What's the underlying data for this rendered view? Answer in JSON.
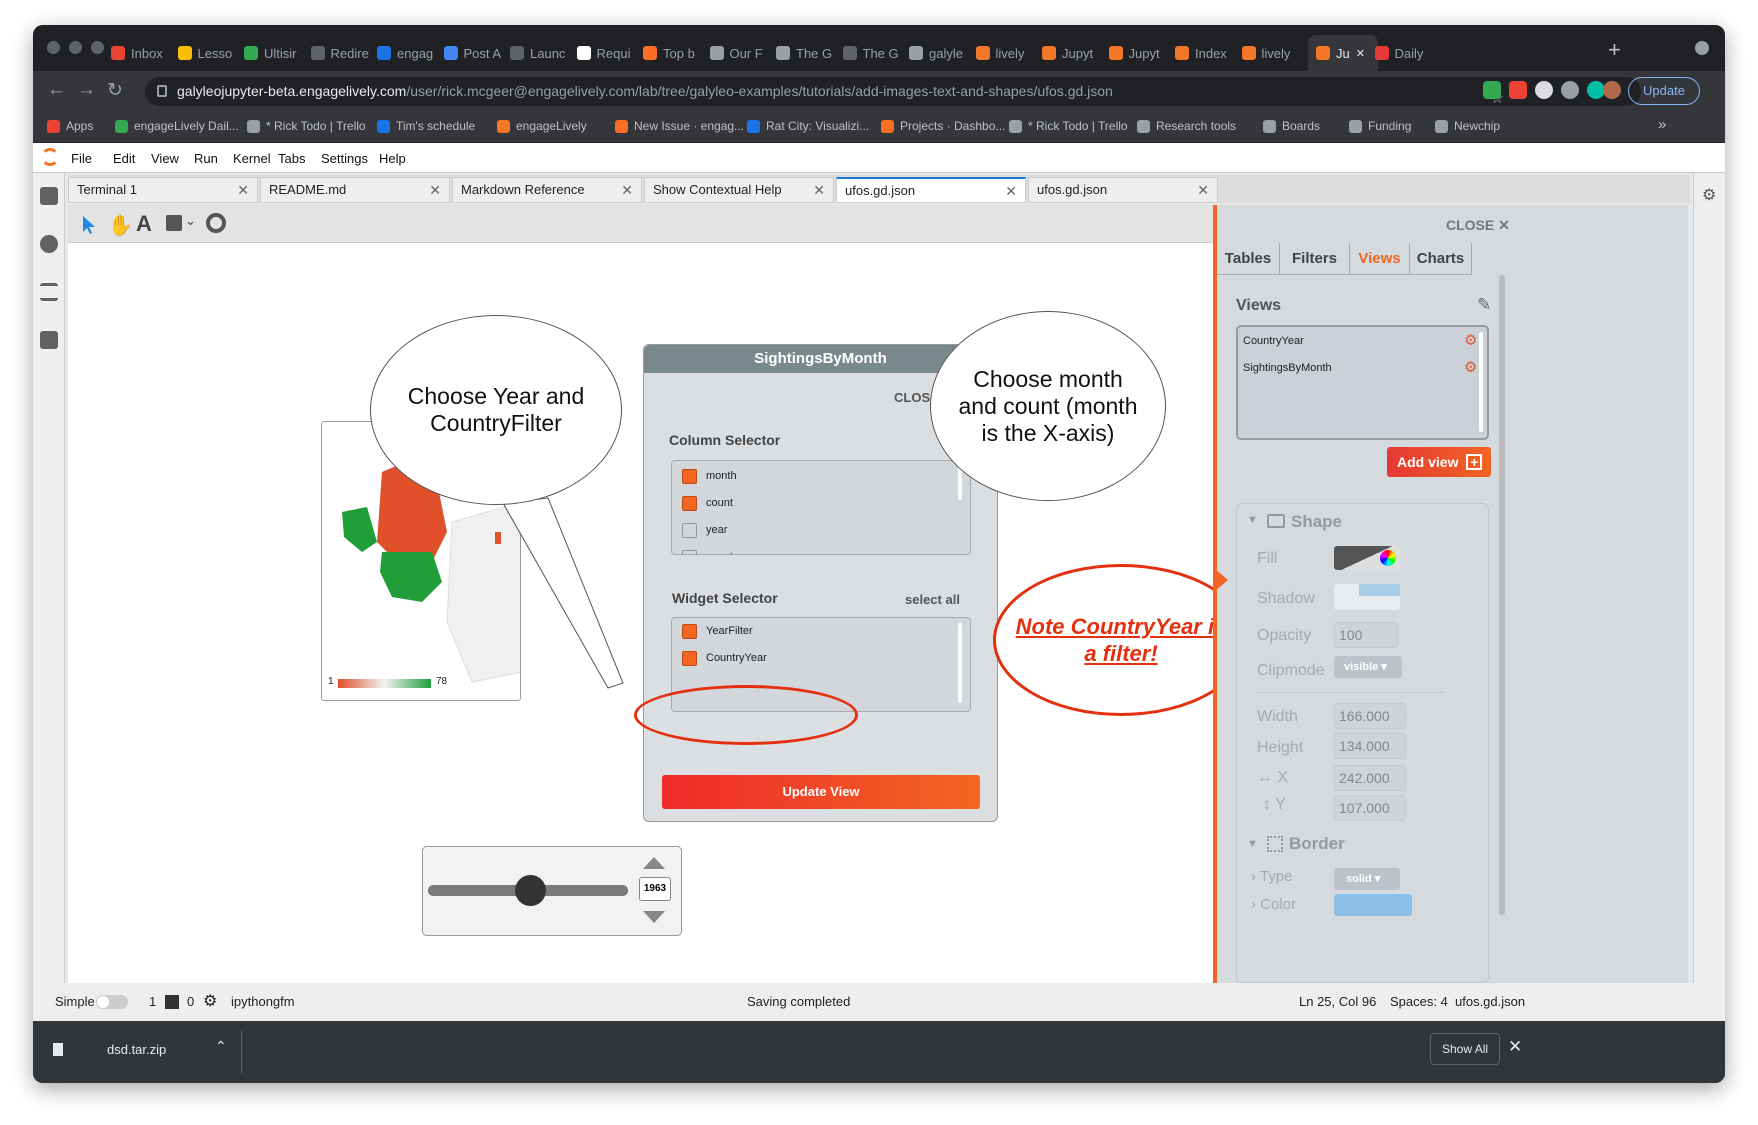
{
  "browser": {
    "tabs": [
      {
        "label": "Inbox",
        "color": "#ea4335"
      },
      {
        "label": "Lesso",
        "color": "#fbbc04"
      },
      {
        "label": "Ultisir",
        "color": "#34a853"
      },
      {
        "label": "Redire",
        "color": "#5f6368"
      },
      {
        "label": "engag",
        "color": "#1a73e8"
      },
      {
        "label": "Post A",
        "color": "#4285f4"
      },
      {
        "label": "Launc",
        "color": "#5f6368"
      },
      {
        "label": "Requi",
        "color": "#ffffff"
      },
      {
        "label": "Top b",
        "color": "#fc6d26"
      },
      {
        "label": "Our F",
        "color": "#9aa0a6"
      },
      {
        "label": "The G",
        "color": "#9aa0a6"
      },
      {
        "label": "The G",
        "color": "#5f6368"
      },
      {
        "label": "galyle",
        "color": "#9aa0a6"
      },
      {
        "label": "lively",
        "color": "#f37726"
      },
      {
        "label": "Jupyt",
        "color": "#f37726"
      },
      {
        "label": "Jupyt",
        "color": "#f37726"
      },
      {
        "label": "Index",
        "color": "#f37726"
      },
      {
        "label": "lively",
        "color": "#f37726"
      },
      {
        "label": "Ju",
        "color": "#f37726"
      },
      {
        "label": "Daily",
        "color": "#e53935"
      }
    ],
    "url_host": "galyleojupyter-beta.engagelively.com",
    "url_path": "/user/rick.mcgeer@engagelively.com/lab/tree/galyleo-examples/tutorials/add-images-text-and-shapes/ufos.gd.json",
    "update_label": "Update",
    "bookmarks": [
      {
        "label": "Apps",
        "color": "#ea4335"
      },
      {
        "label": "engageLively Dail...",
        "color": "#34a853"
      },
      {
        "label": "* Rick Todo | Trello",
        "color": "#9aa0a6"
      },
      {
        "label": "Tim's schedule",
        "color": "#1a73e8"
      },
      {
        "label": "engageLively",
        "color": "#f37726"
      },
      {
        "label": "New Issue · engag...",
        "color": "#fc6d26"
      },
      {
        "label": "Rat City: Visualizi...",
        "color": "#1a73e8"
      },
      {
        "label": "Projects · Dashbo...",
        "color": "#fc6d26"
      },
      {
        "label": "* Rick Todo | Trello",
        "color": "#9aa0a6"
      },
      {
        "label": "Research tools",
        "color": "#9aa0a6"
      },
      {
        "label": "Boards",
        "color": "#9aa0a6"
      },
      {
        "label": "Funding",
        "color": "#9aa0a6"
      },
      {
        "label": "Newchip",
        "color": "#9aa0a6"
      }
    ],
    "more_bookmarks": "»"
  },
  "menu": [
    "File",
    "Edit",
    "View",
    "Run",
    "Kernel",
    "Tabs",
    "Settings",
    "Help"
  ],
  "doc_tabs": [
    "Terminal 1",
    "README.md",
    "Markdown Reference",
    "Show Contextual Help",
    "ufos.gd.json",
    "ufos.gd.json"
  ],
  "canvas": {
    "bubble_left": "Choose Year and CountryFilter",
    "bubble_right": "Choose month and count (month is the X-axis)",
    "note": "Note CountryYear is a filter!",
    "legend_min": "1",
    "legend_max": "78",
    "slider_value": "1963",
    "dialog": {
      "title": "SightingsByMonth",
      "close": "CLOSE",
      "column_selector": "Column Selector",
      "columns": [
        {
          "label": "month",
          "checked": true
        },
        {
          "label": "count",
          "checked": true
        },
        {
          "label": "year",
          "checked": false
        },
        {
          "label": "country",
          "checked": false
        }
      ],
      "widget_selector": "Widget Selector",
      "select_all": "select all",
      "widgets": [
        {
          "label": "YearFilter",
          "checked": true
        },
        {
          "label": "CountryYear",
          "checked": true
        }
      ],
      "update_button": "Update View"
    }
  },
  "panel": {
    "close": "CLOSE",
    "tabs": [
      "Tables",
      "Filters",
      "Views",
      "Charts"
    ],
    "active_tab": "Views",
    "views_title": "Views",
    "views": [
      "CountryYear",
      "SightingsByMonth"
    ],
    "add_view": "Add view",
    "shape_title": "Shape",
    "fill_label": "Fill",
    "shadow_label": "Shadow",
    "opacity_label": "Opacity",
    "opacity_value": "100",
    "clipmode_label": "Clipmode",
    "clipmode_value": "visible",
    "width_label": "Width",
    "width_value": "166.000",
    "height_label": "Height",
    "height_value": "134.000",
    "x_label": "X",
    "x_value": "242.000",
    "y_label": "Y",
    "y_value": "107.000",
    "border_title": "Border",
    "type_label": "Type",
    "type_value": "solid",
    "color_label": "Color"
  },
  "statusbar": {
    "mode": "Simple",
    "terminals": "1",
    "kernels": "0",
    "kernel_name": "ipythongfm",
    "message": "Saving completed",
    "position": "Ln 25, Col 96",
    "spaces": "Spaces: 4",
    "file": "ufos.gd.json"
  },
  "download": {
    "file": "dsd.tar.zip",
    "show_all": "Show All"
  }
}
